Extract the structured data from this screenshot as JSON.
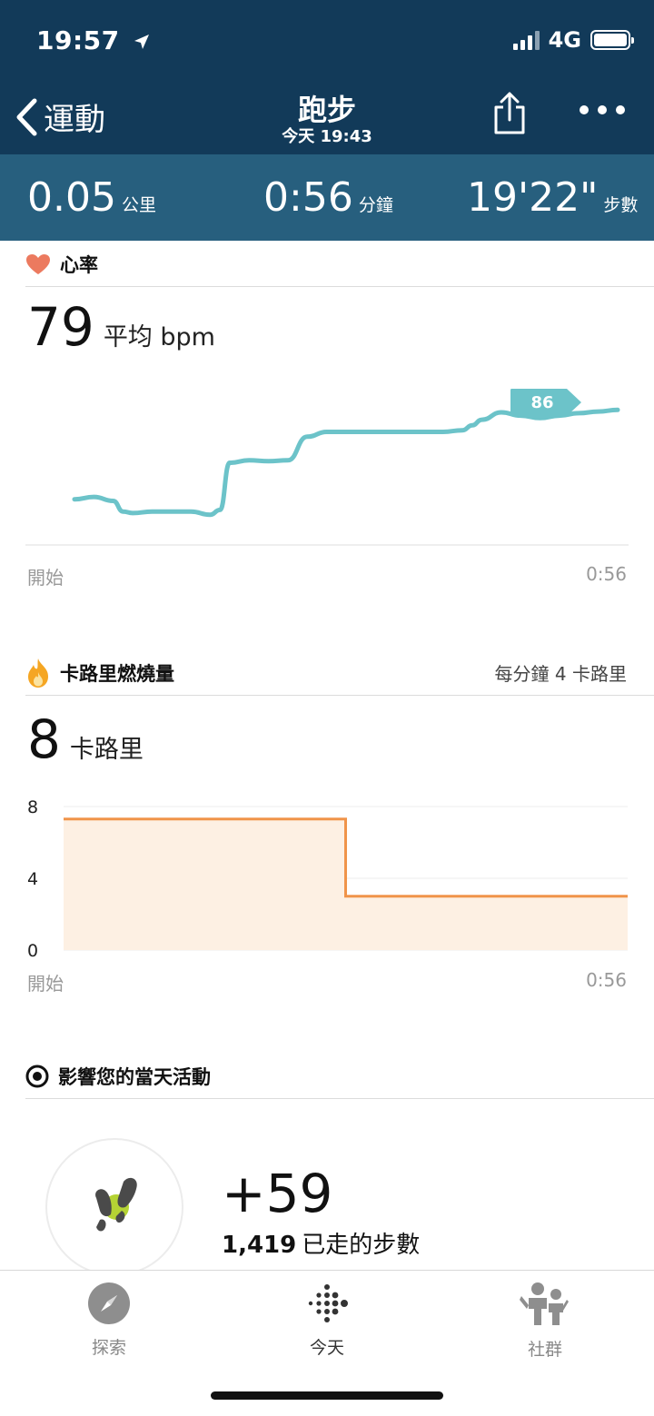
{
  "status": {
    "time": "19:57",
    "network": "4G"
  },
  "nav": {
    "back_label": "運動",
    "title": "跑步",
    "subtitle": "今天 19:43"
  },
  "stats": [
    {
      "value": "0.05",
      "unit": "公里"
    },
    {
      "value": "0:56",
      "unit": "分鐘"
    },
    {
      "value": "19'22\"",
      "unit": "步數"
    }
  ],
  "heart": {
    "title": "心率",
    "avg_value": "79",
    "avg_label": "平均 bpm",
    "peak_label": "86",
    "start_label": "開始",
    "end_label": "0:56",
    "accent": "#6cc3c9"
  },
  "calories": {
    "title": "卡路里燃燒量",
    "rate_label": "每分鐘 4 卡路里",
    "total_value": "8",
    "total_label": "卡路里",
    "start_label": "開始",
    "end_label": "0:56",
    "accent": "#f0944a"
  },
  "impact": {
    "title": "影響您的當天活動",
    "delta": "+59",
    "steps_value": "1,419",
    "steps_label": "已走的步數"
  },
  "tabs": [
    {
      "label": "探索",
      "icon": "compass-icon"
    },
    {
      "label": "今天",
      "icon": "fitbit-dots-icon"
    },
    {
      "label": "社群",
      "icon": "community-icon"
    }
  ],
  "chart_data": [
    {
      "type": "line",
      "x": [
        0,
        2,
        4,
        5,
        6,
        8,
        10,
        12,
        14,
        15,
        16,
        18,
        20,
        22,
        24,
        26,
        27,
        28,
        30,
        32,
        34,
        36,
        38,
        40,
        41,
        42,
        44,
        46,
        48,
        50,
        52,
        54,
        56
      ],
      "y": [
        72.5,
        72.8,
        72.3,
        71,
        70.8,
        71,
        71,
        71,
        70.6,
        71.2,
        77,
        77.3,
        77.2,
        77.3,
        80.2,
        80.8,
        80.8,
        80.8,
        80.8,
        80.8,
        80.8,
        80.8,
        80.8,
        81,
        81.6,
        82.3,
        83.2,
        82.8,
        82.5,
        82.8,
        83.1,
        83.3,
        83.5
      ],
      "annotation": "86",
      "xlabel": "",
      "ylabel": "",
      "xlim": [
        0,
        56
      ],
      "ylim": [
        68,
        87
      ],
      "tick_labels": [
        "開始",
        "0:56"
      ]
    },
    {
      "type": "area",
      "x": [
        0,
        28,
        28,
        56
      ],
      "y": [
        7.3,
        7.3,
        3,
        3
      ],
      "ylim": [
        0,
        8
      ],
      "yticks": [
        0,
        4,
        8
      ],
      "tick_labels": [
        "開始",
        "0:56"
      ],
      "grid": true
    }
  ]
}
